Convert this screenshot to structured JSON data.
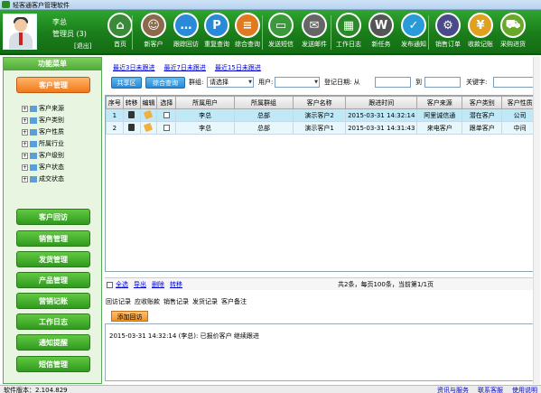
{
  "window": {
    "title": "轻客通客户管理软件"
  },
  "user": {
    "name": "李总",
    "role": "管理员 (3)",
    "logout": "[退出]"
  },
  "toolbar": [
    {
      "label": "首页",
      "icon": "home-icon",
      "color": "#3a8a3a",
      "glyph": "⌂"
    },
    {
      "label": "新客户",
      "icon": "person-icon",
      "color": "#8a6a4a",
      "glyph": "☺"
    },
    {
      "label": "跟踪回访",
      "icon": "chat-icon",
      "color": "#2a8ad8",
      "glyph": "…"
    },
    {
      "label": "重复查询",
      "icon": "p-icon",
      "color": "#2a8ad8",
      "glyph": "P"
    },
    {
      "label": "综合查询",
      "icon": "list-icon",
      "color": "#e07a20",
      "glyph": "≡"
    },
    {
      "label": "发送短信",
      "icon": "sms-icon",
      "color": "#3a9a3a",
      "glyph": "▭"
    },
    {
      "label": "发送邮件",
      "icon": "mail-icon",
      "color": "#666666",
      "glyph": "✉"
    },
    {
      "label": "工作日志",
      "icon": "calendar-icon",
      "color": "#2a8a2a",
      "glyph": "▦"
    },
    {
      "label": "新任务",
      "icon": "task-icon",
      "color": "#555555",
      "glyph": "W"
    },
    {
      "label": "发布通知",
      "icon": "bird-icon",
      "color": "#2a9ad8",
      "glyph": "✓"
    },
    {
      "label": "销售订单",
      "icon": "order-icon",
      "color": "#4a4a8a",
      "glyph": "⚙"
    },
    {
      "label": "收款记账",
      "icon": "money-icon",
      "color": "#e0a020",
      "glyph": "¥"
    },
    {
      "label": "采购进货",
      "icon": "cart-icon",
      "color": "#6aa82a",
      "glyph": "⛟"
    }
  ],
  "sidebar": {
    "header": "功能菜单",
    "active": "客户管理",
    "tree": [
      "客户来源",
      "客户类别",
      "客户性质",
      "所属行业",
      "客户级别",
      "客户状态",
      "成交状态"
    ],
    "buttons": [
      "客户回访",
      "销售管理",
      "发货管理",
      "产品管理",
      "营销记账",
      "工作日志",
      "通知提醒",
      "短信管理"
    ]
  },
  "main": {
    "quick_links": [
      "最近3日未跟进",
      "最近7日未跟进",
      "最近15日未跟进"
    ],
    "filter": {
      "shared_btn": "共享区",
      "query_btn": "综合查询",
      "group_label": "群组:",
      "group_value": "请选择",
      "user_label": "用户:",
      "date_label": "登记日期: 从",
      "to_label": "到",
      "keyword_label": "关键字:"
    },
    "columns": [
      "序号",
      "转移",
      "编辑",
      "选择",
      "所属用户",
      "所属群组",
      "客户名称",
      "跟进时间",
      "客户来源",
      "客户类别",
      "客户性质"
    ],
    "rows": [
      [
        "1",
        "",
        "",
        "",
        "李总",
        "总部",
        "演示客户2",
        "2015-03-31 14:32:14",
        "阿里诚信通",
        "潜在客户",
        "公司"
      ],
      [
        "2",
        "",
        "",
        "",
        "李总",
        "总部",
        "演示客户1",
        "2015-03-31 14:31:43",
        "来电客户",
        "跟单客户",
        "中间"
      ]
    ],
    "footer_links": [
      "全选",
      "导出",
      "删除",
      "转移"
    ],
    "pager": "共2条，每页100条，当前第1/1页",
    "subtabs": [
      "回访记录",
      "应收账款",
      "销售记录",
      "发货记录",
      "客户备注"
    ],
    "add_btn": "添加回访",
    "detail_text": "2015-03-31 14:32:14 (李总): 已报价客户 继续跟进"
  },
  "status": {
    "version": "软件版本：2.104.829",
    "links": [
      "资讯与服务",
      "联系客服",
      "使用说明"
    ]
  }
}
